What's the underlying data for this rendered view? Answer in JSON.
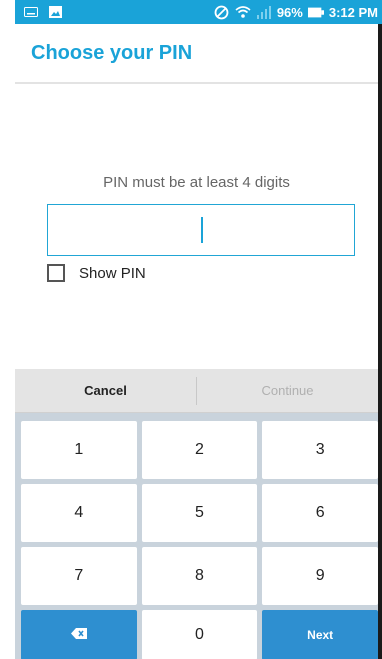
{
  "status_bar": {
    "battery": "96%",
    "time": "3:12 PM",
    "icons": [
      "keyboard-icon",
      "image-icon",
      "no-disturb-icon",
      "wifi-icon",
      "signal-icon",
      "battery-icon"
    ]
  },
  "appbar": {
    "title": "Choose your PIN"
  },
  "form": {
    "hint": "PIN must be at least 4 digits",
    "pin_value": "",
    "show_pin_label": "Show PIN",
    "show_pin_checked": false
  },
  "actions": {
    "cancel": "Cancel",
    "continue": "Continue"
  },
  "keypad": {
    "rows": [
      [
        "1",
        "2",
        "3"
      ],
      [
        "4",
        "5",
        "6"
      ],
      [
        "7",
        "8",
        "9"
      ]
    ],
    "zero": "0",
    "next": "Next",
    "backspace_icon": "backspace-icon"
  },
  "colors": {
    "accent": "#1aa3d8",
    "keypad_bg": "#c9d3dc",
    "key_dark": "#2e8fd0"
  }
}
